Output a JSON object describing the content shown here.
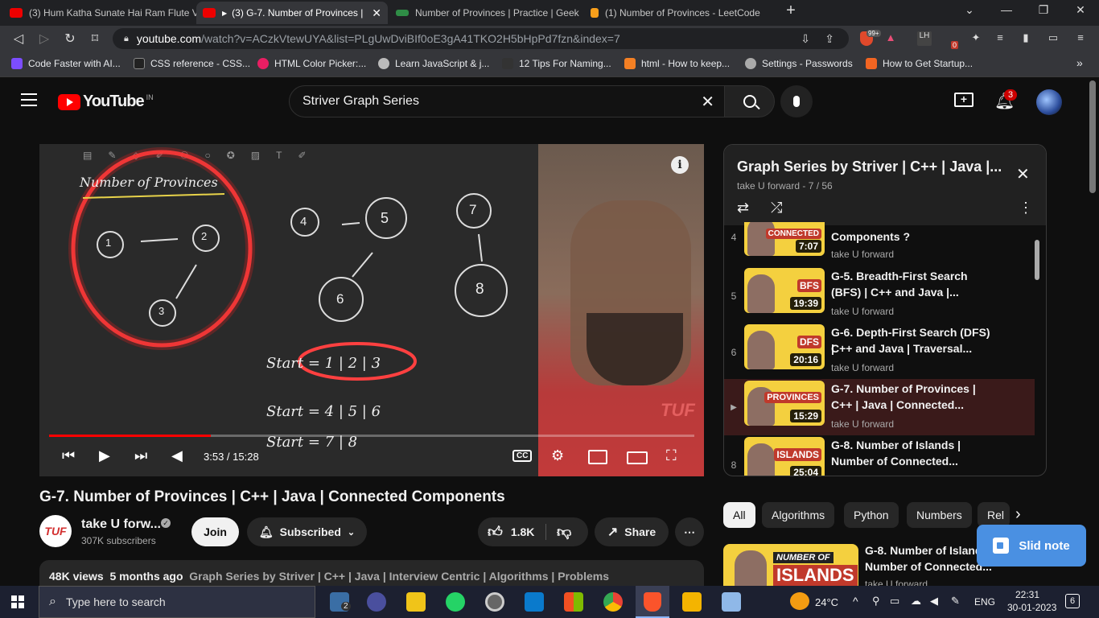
{
  "browser": {
    "tabs": [
      {
        "title": "(3) Hum Katha Sunate Hai Ram Flute V",
        "active": false
      },
      {
        "title": "(3) G-7. Number of Provinces | ",
        "active": true
      },
      {
        "title": "Number of Provinces | Practice | Geek",
        "active": false
      },
      {
        "title": "(1) Number of Provinces - LeetCode",
        "active": false
      }
    ],
    "new_tab": "+",
    "url_host": "youtube.com",
    "url_path": "/watch?v=ACzkVtewUYA&list=PLgUwDviBIf0oE3gA41TKO2H5bHpPd7fzn&index=7",
    "brave_badge": "99+",
    "ext_badge": "0",
    "bookmarks": [
      "Code Faster with AI...",
      "CSS reference - CSS...",
      "HTML Color Picker:...",
      "Learn JavaScript & j...",
      "12 Tips For Naming...",
      "html - How to keep...",
      "Settings - Passwords",
      "How to Get Startup..."
    ],
    "bookmarks_more": "»"
  },
  "youtube": {
    "logo": "YouTube",
    "region": "IN",
    "search_value": "Striver Graph Series",
    "notification_count": "3"
  },
  "player": {
    "time": "3:53 / 15:28",
    "progress": 0.251,
    "board_title": "Number of Provinces",
    "watermark": "TUF",
    "board_nodes": [
      "1",
      "2",
      "3",
      "4",
      "5",
      "6",
      "7",
      "8"
    ],
    "board_lines": [
      "Start = 1 | 2 | 3",
      "Start = 4 | 5 | 6",
      "Start = 7 | 8"
    ]
  },
  "video": {
    "title": "G-7. Number of Provinces | C++ | Java | Connected Components",
    "channel": "take U forw...",
    "subscribers": "307K subscribers",
    "join": "Join",
    "subscribed": "Subscribed",
    "likes": "1.8K",
    "share": "Share",
    "views": "48K views",
    "age": "5 months ago",
    "tags": "Graph Series by Striver | C++ | Java | Interview Centric | Algorithms | Problems"
  },
  "playlist": {
    "title": "Graph Series by Striver | C++ | Java |...",
    "subtitle": "take U forward - 7 / 56",
    "items": [
      {
        "index": "4",
        "title_l1": "Components ?",
        "title_l2": "",
        "channel": "take U forward",
        "duration": "7:07",
        "thumb_label": "CONNECTED",
        "active": false
      },
      {
        "index": "5",
        "title_l1": "G-5. Breadth-First Search",
        "title_l2": "(BFS) | C++ and Java |...",
        "channel": "take U forward",
        "duration": "19:39",
        "thumb_label": "BFS",
        "active": false
      },
      {
        "index": "6",
        "title_l1": "G-6. Depth-First Search (DFS) |",
        "title_l2": "C++ and Java | Traversal...",
        "channel": "take U forward",
        "duration": "20:16",
        "thumb_label": "DFS",
        "active": false
      },
      {
        "index": "▶",
        "title_l1": "G-7. Number of Provinces |",
        "title_l2": "C++ | Java | Connected...",
        "channel": "take U forward",
        "duration": "15:29",
        "thumb_label": "PROVINCES",
        "active": true
      },
      {
        "index": "8",
        "title_l1": "G-8. Number of Islands |",
        "title_l2": "Number of Connected...",
        "channel": "take U forward",
        "duration": "25:04",
        "thumb_label": "ISLANDS",
        "active": false
      }
    ]
  },
  "chips": [
    "All",
    "Algorithms",
    "Python",
    "Numbers",
    "Rel"
  ],
  "recommended": {
    "title_l1": "G-8. Number of Islands |",
    "title_l2": "Number of Connected...",
    "channel": "take U forward",
    "thumb_label1": "NUMBER OF",
    "thumb_label2": "ISLANDS"
  },
  "slid_note": "Slid note",
  "taskbar": {
    "search_placeholder": "Type here to search",
    "weather": "24°C",
    "lang": "ENG",
    "time": "22:31",
    "date": "30-01-2023",
    "notif_count": "6",
    "task_badge": "2"
  }
}
